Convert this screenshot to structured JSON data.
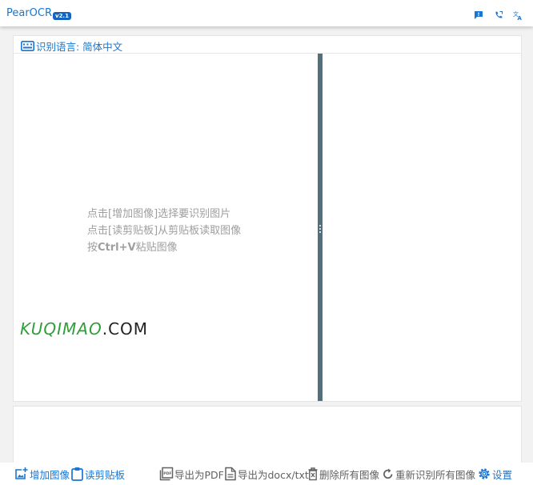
{
  "app": {
    "title": "PearOCR",
    "version": "v2.1"
  },
  "header_icons": [
    "feedback-icon",
    "phone-icon",
    "translate-icon"
  ],
  "language_bar": {
    "label": "识别语言: 简体中文"
  },
  "hints": {
    "line1": "点击[增加图像]选择要识别图片",
    "line2": "点击[读剪贴板]从剪贴板读取图像",
    "line3_prefix": "按",
    "line3_key": "Ctrl+V",
    "line3_suffix": "粘贴图像"
  },
  "watermark": {
    "part1": "KUQIMAO",
    "part2": ".COM"
  },
  "toolbar": {
    "add_image": "增加图像",
    "read_clipboard": "读剪贴板",
    "export_pdf": "导出为PDF",
    "export_docx": "导出为docx/txt",
    "delete_all": "删除所有图像",
    "rerecognize_all": "重新识别所有图像",
    "settings": "设置"
  },
  "colors": {
    "accent": "#1976d2",
    "splitter": "#546e7a",
    "hint_text": "#9e9e9e",
    "toolbar_grey": "#616161"
  }
}
